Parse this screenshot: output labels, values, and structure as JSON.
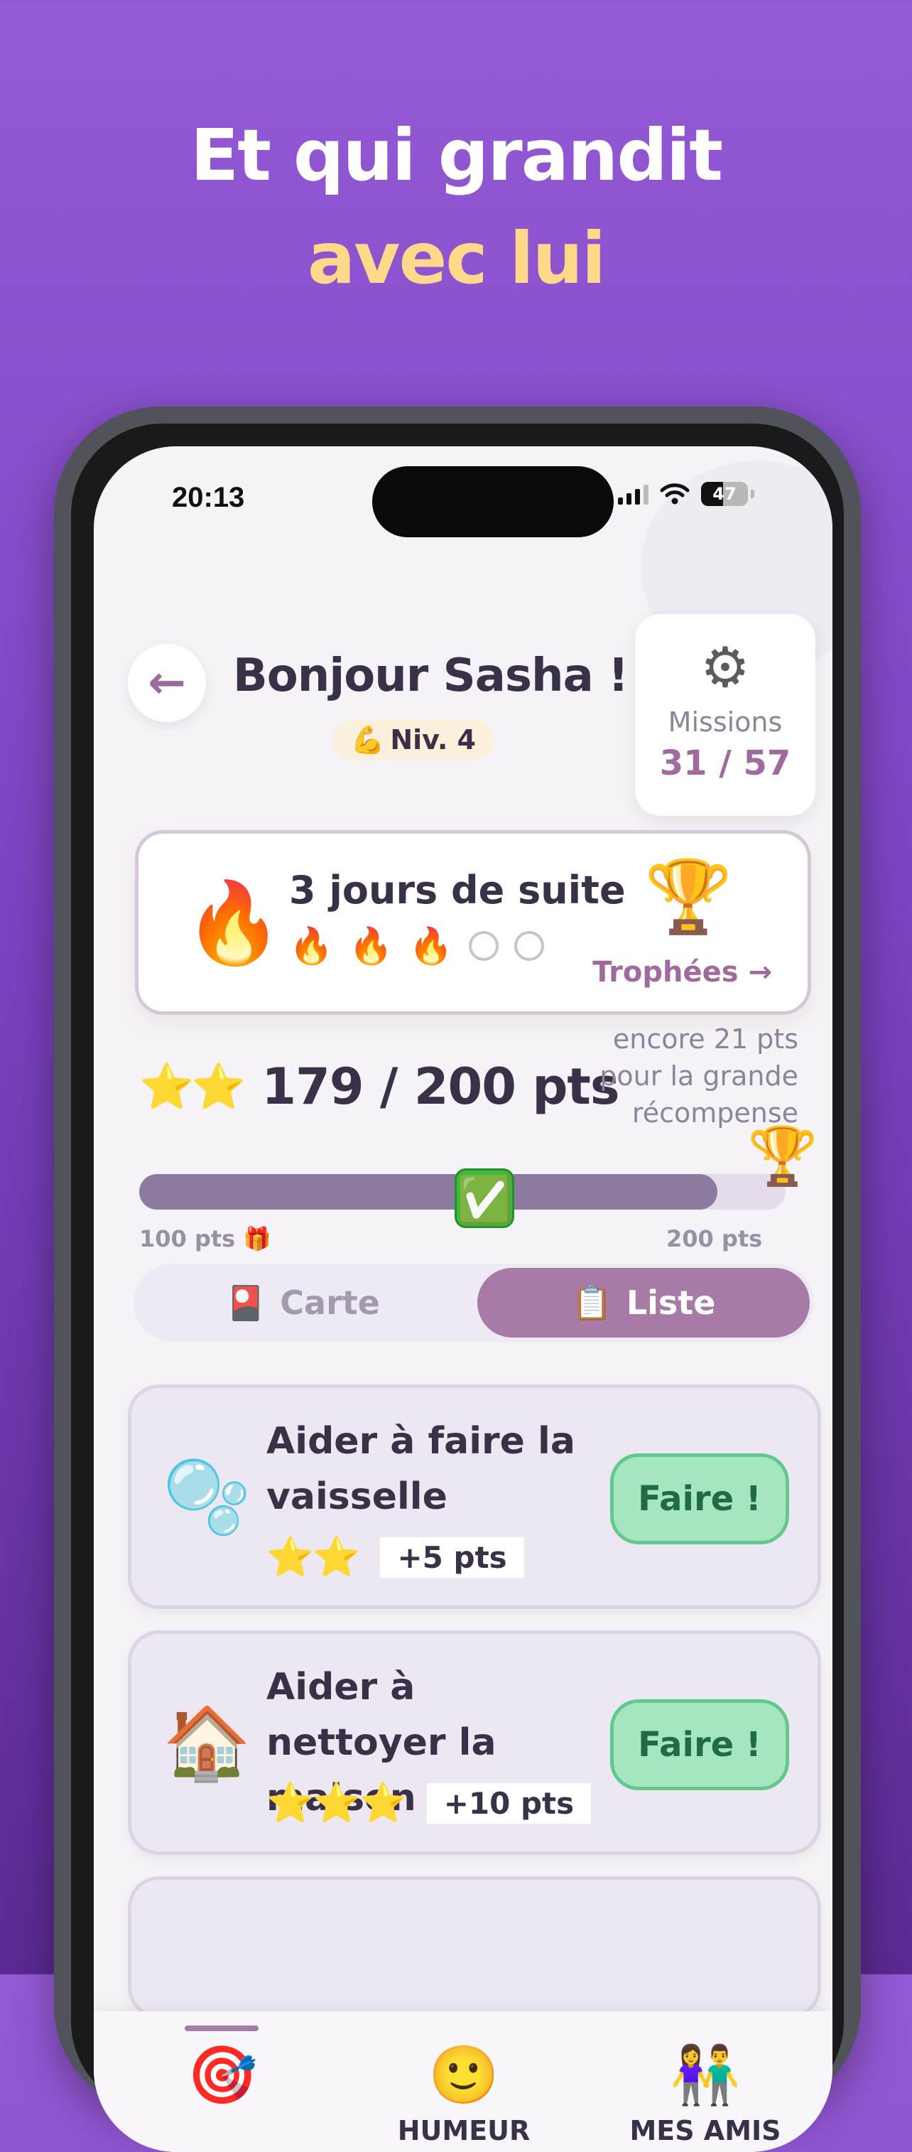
{
  "headline": {
    "line1": "Et qui grandit",
    "line2": "avec lui"
  },
  "status_bar": {
    "time": "20:13",
    "battery": "47"
  },
  "header": {
    "greeting": "Bonjour Sasha !",
    "level_emoji": "💪",
    "level": "Niv. 4",
    "missions_label": "Missions",
    "missions_count": "31 / 57"
  },
  "streak": {
    "fire_emoji": "🔥",
    "text": "3 jours de suite",
    "days_done": 3,
    "days_total": 5,
    "trophy_emoji": "🏆",
    "trophies_link": "Trophées →"
  },
  "points": {
    "stars": "⭐⭐",
    "text": "179 / 200 pts",
    "reward_note": "encore 21 pts pour la grande récompense",
    "progress": 0.895,
    "check_emoji": "✅",
    "milestone_100": "100 pts 🎁",
    "milestone_200": "200 pts",
    "trophy_emoji": "🏆"
  },
  "toggle": {
    "carte_icon": "🎴",
    "carte_label": "Carte",
    "liste_icon": "📋",
    "liste_label": "Liste",
    "selected": "Liste"
  },
  "missions": [
    {
      "icon": "🫧",
      "title": "Aider à faire la vaisselle",
      "stars": "⭐⭐",
      "points": "+5 pts",
      "button": "Faire !"
    },
    {
      "icon": "🏠",
      "title": "Aider à nettoyer la maison",
      "stars": "⭐⭐⭐",
      "points": "+10 pts",
      "button": "Faire !"
    }
  ],
  "tabs": [
    {
      "icon": "🎯",
      "label": "",
      "active": true
    },
    {
      "icon": "🙂",
      "label": "HUMEUR",
      "active": false
    },
    {
      "icon": "👫",
      "label": "MES AMIS",
      "active": false
    }
  ],
  "colors": {
    "background": "#8e52d0",
    "accent": "#a87ba6",
    "headline_highlight": "#ffd98a",
    "do_button": "#a5e6c1"
  }
}
